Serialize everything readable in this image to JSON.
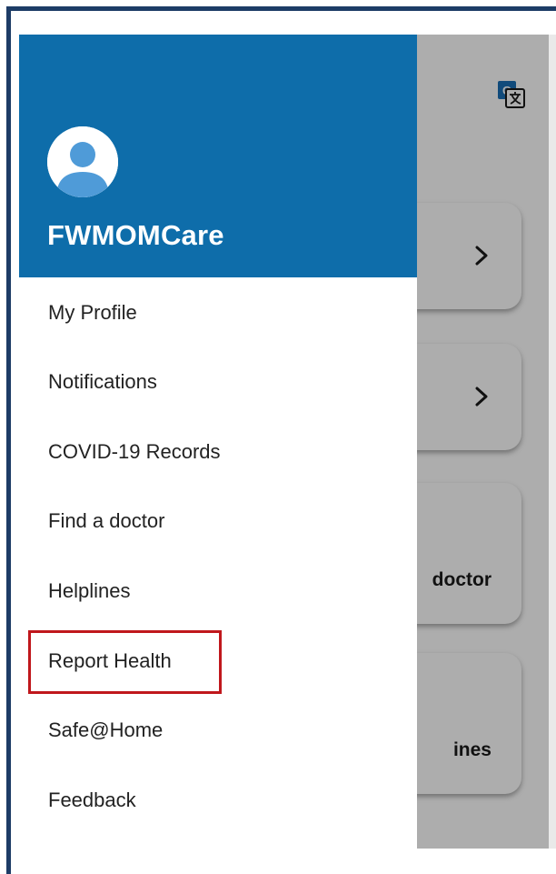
{
  "app": {
    "name": "FWMOMCare"
  },
  "drawer": {
    "menu_items": [
      {
        "label": "My Profile"
      },
      {
        "label": "Notifications"
      },
      {
        "label": "COVID-19 Records"
      },
      {
        "label": "Find a doctor"
      },
      {
        "label": "Helplines"
      },
      {
        "label": "Report Health"
      },
      {
        "label": "Safe@Home"
      },
      {
        "label": "Feedback"
      }
    ]
  },
  "background": {
    "cards": [
      {
        "label": ""
      },
      {
        "label": ""
      },
      {
        "label": "doctor"
      },
      {
        "label": "ines"
      }
    ]
  },
  "colors": {
    "header": "#0e6daa",
    "highlight": "#c0171c",
    "frame": "#1d3c66"
  },
  "icons": [
    "translate-icon",
    "chevron-right-icon",
    "search-icon",
    "helpline-person-icon",
    "avatar-icon"
  ]
}
